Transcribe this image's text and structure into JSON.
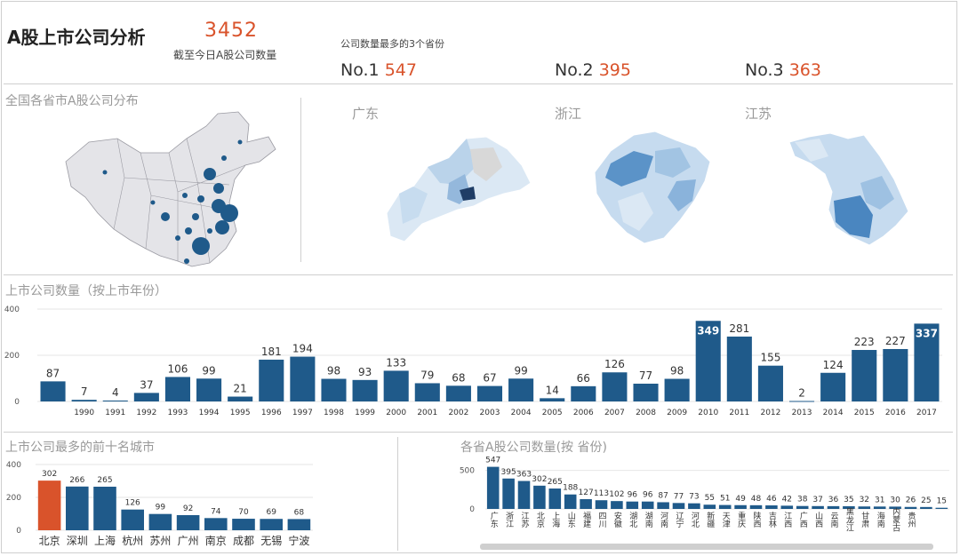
{
  "header": {
    "title": "A股上市公司分析",
    "total": "3452",
    "total_caption": "截至今日A股公司数量",
    "top3_title": "公司数量最多的3个省份",
    "top3": [
      {
        "rank": "No.1",
        "value": "547"
      },
      {
        "rank": "No.2",
        "value": "395"
      },
      {
        "rank": "No.3",
        "value": "363"
      }
    ]
  },
  "map_section": {
    "title": "全国各省市A股公司分布",
    "provinces": [
      "广东",
      "浙江",
      "江苏"
    ]
  },
  "colors": {
    "bar": "#1f5a8a",
    "highlight": "#d9532b",
    "accent_text": "#d9532b",
    "grid": "#e6e6e6"
  },
  "chart_data": [
    {
      "type": "bar",
      "title": "上市公司数量（按上市年份）",
      "categories": [
        "",
        "1990",
        "1991",
        "1992",
        "1993",
        "1994",
        "1995",
        "1996",
        "1997",
        "1998",
        "1999",
        "2000",
        "2001",
        "2002",
        "2003",
        "2004",
        "2005",
        "2006",
        "2007",
        "2008",
        "2009",
        "2010",
        "2011",
        "2012",
        "2013",
        "2014",
        "2015",
        "2016",
        "2017"
      ],
      "values": [
        87,
        7,
        4,
        37,
        106,
        99,
        21,
        181,
        194,
        98,
        93,
        133,
        79,
        68,
        67,
        99,
        14,
        66,
        126,
        77,
        98,
        349,
        281,
        155,
        2,
        124,
        223,
        227,
        337
      ],
      "bold_labels": [
        "2010",
        "2017"
      ],
      "ylim": [
        0,
        400
      ],
      "yticks": [
        0,
        200,
        400
      ],
      "grid": true
    },
    {
      "type": "bar",
      "title": "上市公司最多的前十名城市",
      "categories": [
        "北京",
        "深圳",
        "上海",
        "杭州",
        "苏州",
        "广州",
        "南京",
        "成都",
        "无锡",
        "宁波"
      ],
      "values": [
        302,
        266,
        265,
        126,
        99,
        92,
        74,
        70,
        69,
        68
      ],
      "highlight": [
        "北京"
      ],
      "ylim": [
        0,
        400
      ],
      "yticks": [
        0,
        200,
        400
      ],
      "grid": true
    },
    {
      "type": "bar",
      "title": "各省A股公司数量(按 省份)",
      "categories": [
        "广东",
        "浙江",
        "江苏",
        "北京",
        "上海",
        "山东",
        "福建",
        "四川",
        "安徽",
        "湖北",
        "湖南",
        "河南",
        "辽宁",
        "河北",
        "新疆",
        "天津",
        "重庆",
        "陕西",
        "吉林",
        "江西",
        "广西",
        "山西",
        "云南",
        "黑龙江",
        "甘肃",
        "海南",
        "内蒙古",
        "贵州"
      ],
      "values": [
        547,
        395,
        363,
        302,
        265,
        188,
        127,
        113,
        102,
        96,
        96,
        87,
        77,
        73,
        55,
        51,
        49,
        48,
        46,
        42,
        38,
        37,
        36,
        35,
        32,
        31,
        30,
        26,
        25,
        15
      ],
      "ylim": [
        0,
        600
      ],
      "yticks": [
        0,
        500
      ],
      "grid": true
    }
  ]
}
